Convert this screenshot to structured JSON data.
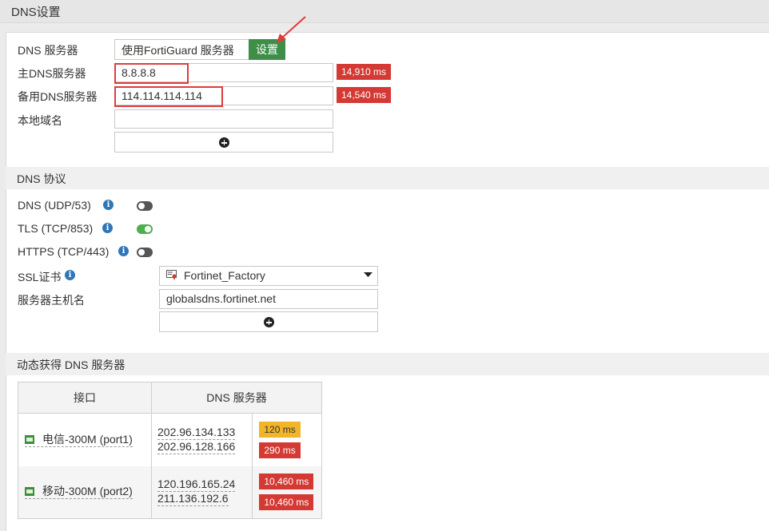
{
  "header": {
    "title": "DNS设置"
  },
  "dns_servers": {
    "server_label": "DNS 服务器",
    "use_fortiguard_label": "使用FortiGuard 服务器",
    "settings_button": "设置",
    "primary_label": "主DNS服务器",
    "primary_value": "8.8.8.8",
    "primary_latency": "14,910 ms",
    "secondary_label": "备用DNS服务器",
    "secondary_value": "114.114.114.114",
    "secondary_latency": "14,540 ms",
    "local_domain_label": "本地域名",
    "local_domain_value": ""
  },
  "protocols": {
    "section_title": "DNS 协议",
    "items": [
      {
        "label": "DNS (UDP/53)",
        "enabled": false
      },
      {
        "label": "TLS (TCP/853)",
        "enabled": true
      },
      {
        "label": "HTTPS (TCP/443)",
        "enabled": false
      }
    ],
    "ssl_cert_label": "SSL证书",
    "ssl_cert_value": "Fortinet_Factory",
    "hostname_label": "服务器主机名",
    "hostname_value": "globalsdns.fortinet.net"
  },
  "dynamic": {
    "section_title": "动态获得 DNS 服务器",
    "col_interface": "接口",
    "col_dns": "DNS 服务器",
    "rows": [
      {
        "interface": "电信-300M (port1)",
        "servers": [
          "202.96.134.133",
          "202.96.128.166"
        ],
        "latencies": [
          "120 ms",
          "290 ms"
        ],
        "latency_colors": [
          "#f0b528",
          "#d43a33"
        ]
      },
      {
        "interface": "移动-300M (port2)",
        "servers": [
          "120.196.165.24",
          "211.136.192.6"
        ],
        "latencies": [
          "10,460 ms",
          "10,460 ms"
        ],
        "latency_colors": [
          "#d43a33",
          "#d43a33"
        ]
      }
    ]
  },
  "colors": {
    "accent_green": "#3e8e48",
    "latency_red": "#d43a33",
    "latency_yellow": "#f0b528",
    "highlight_red": "#e03b3b"
  }
}
